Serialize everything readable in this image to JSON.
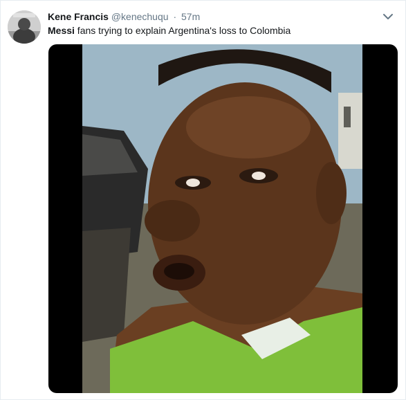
{
  "tweet": {
    "author_name": "Kene Francis",
    "handle": "@kenechuqu",
    "separator": "·",
    "timestamp": "57m",
    "text_bold": "Messi",
    "text_rest": " fans trying to explain Argentina's loss to Colombia"
  },
  "icons": {
    "menu": "chevron-down-icon"
  },
  "colors": {
    "name": "#14171a",
    "meta": "#657786",
    "border": "#e6ecf0",
    "video_letterbox": "#000000"
  }
}
